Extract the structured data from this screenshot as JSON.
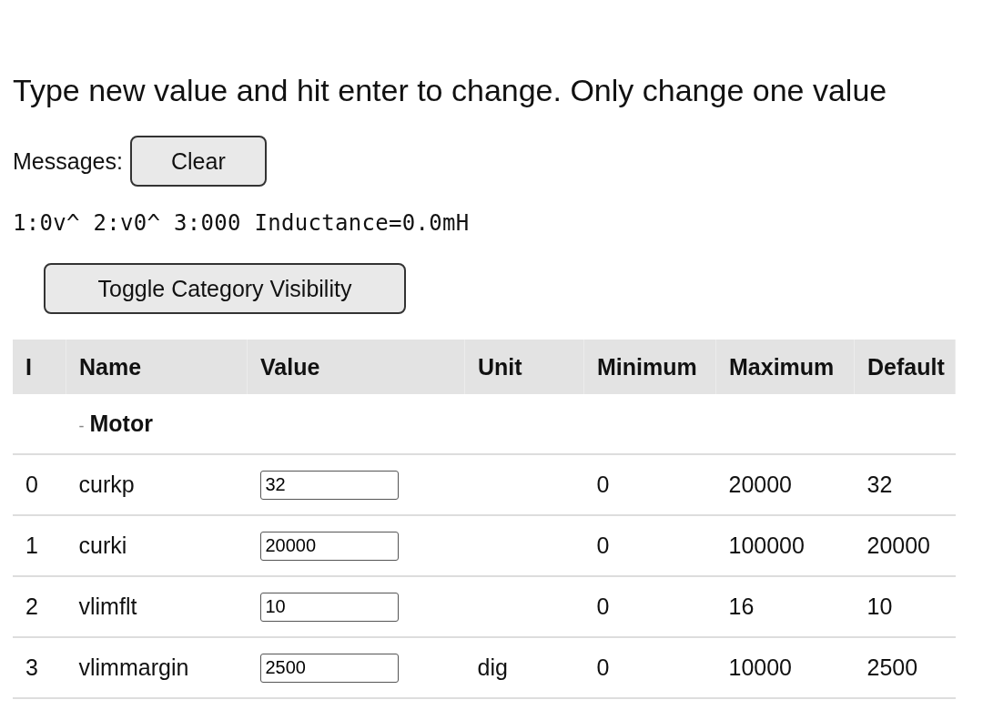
{
  "instruction": "Type new value and hit enter to change. Only change one value",
  "messages": {
    "label": "Messages:",
    "clear_button": "Clear",
    "text": "1:0v^ 2:v0^ 3:000 Inductance=0.0mH"
  },
  "toggle_button": "Toggle Category Visibility",
  "table": {
    "columns": [
      "I",
      "Name",
      "Value",
      "Unit",
      "Minimum",
      "Maximum",
      "Default"
    ],
    "rows": [
      {
        "kind": "category",
        "toggle": "-",
        "name": "Motor"
      },
      {
        "kind": "param",
        "index": "0",
        "name": "curkp",
        "value": "32",
        "unit": "",
        "minimum": "0",
        "maximum": "20000",
        "default": "32"
      },
      {
        "kind": "param",
        "index": "1",
        "name": "curki",
        "value": "20000",
        "unit": "",
        "minimum": "0",
        "maximum": "100000",
        "default": "20000"
      },
      {
        "kind": "param",
        "index": "2",
        "name": "vlimflt",
        "value": "10",
        "unit": "",
        "minimum": "0",
        "maximum": "16",
        "default": "10"
      },
      {
        "kind": "param",
        "index": "3",
        "name": "vlimmargin",
        "value": "2500",
        "unit": "dig",
        "minimum": "0",
        "maximum": "10000",
        "default": "2500"
      }
    ]
  }
}
